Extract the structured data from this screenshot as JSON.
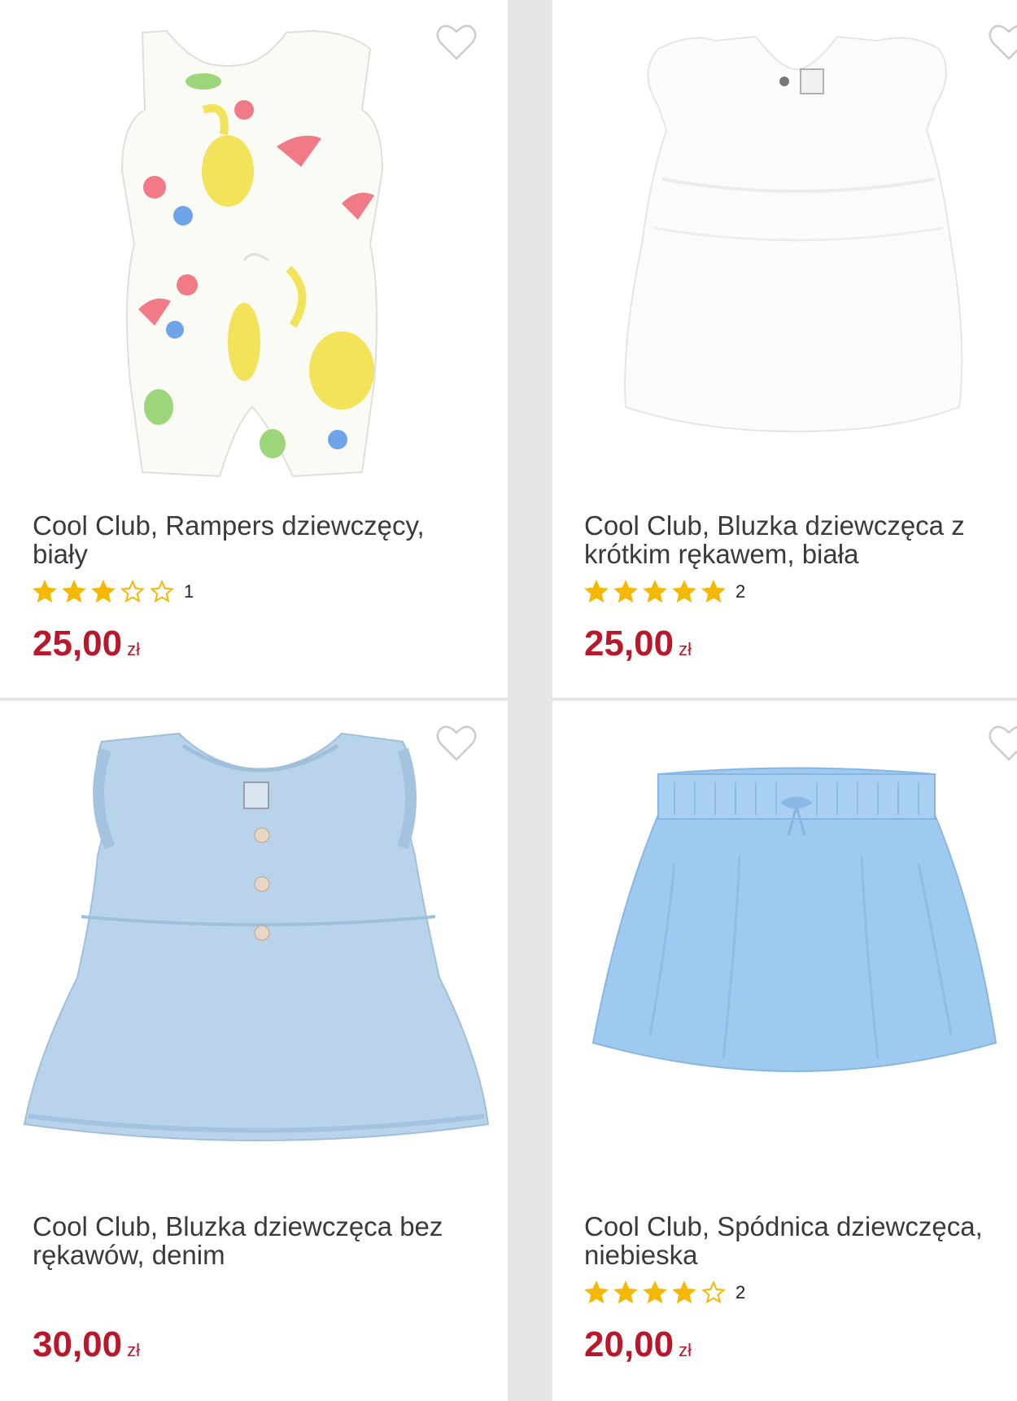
{
  "products": [
    {
      "title": "Cool Club, Rampers dziewczęcy, biały",
      "rating_stars": 3,
      "rating_count": "1",
      "price": "25,00",
      "currency": "zł",
      "image_icon": "fruit-print-romper-image"
    },
    {
      "title": "Cool Club, Bluzka dziewczęca z krótkim rękawem, biała",
      "rating_stars": 5,
      "rating_count": "2",
      "price": "25,00",
      "currency": "zł",
      "image_icon": "white-blouse-image"
    },
    {
      "title": "Cool Club, Bluzka dziewczęca bez rękawów, denim",
      "rating_stars": 0,
      "rating_count": "",
      "price": "30,00",
      "currency": "zł",
      "image_icon": "denim-blouse-image"
    },
    {
      "title": "Cool Club, Spódnica dziewczęca, niebieska",
      "rating_stars": 4,
      "rating_count": "2",
      "price": "20,00",
      "currency": "zł",
      "image_icon": "blue-skirt-image"
    }
  ],
  "colors": {
    "price": "#b7182b",
    "star": "#f5b800",
    "heart": "#cccccc"
  }
}
